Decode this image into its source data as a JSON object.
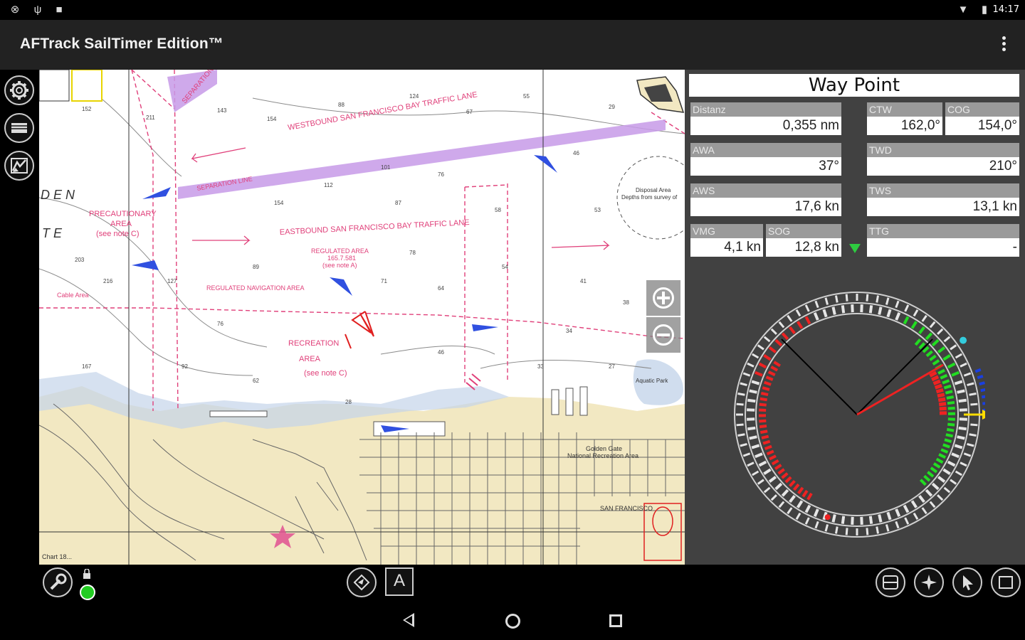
{
  "status_bar": {
    "time": "14:17",
    "left_icons": [
      "sync-icon",
      "usb-icon",
      "notification-icon"
    ],
    "right_icons": [
      "wifi-icon",
      "battery-icon"
    ]
  },
  "app": {
    "title": "AFTrack SailTimer Edition™"
  },
  "left_toolbar": {
    "buttons": [
      "settings-gear-icon",
      "layers-icon",
      "chart-map-icon"
    ]
  },
  "chart": {
    "labels": {
      "westbound": "WESTBOUND SAN FRANCISCO BAY TRAFFIC LANE",
      "eastbound": "EASTBOUND SAN FRANCISCO BAY TRAFFIC LANE",
      "precautionary": "PRECAUTIONARY",
      "precautionary_area": "AREA",
      "precautionary_note": "(see note C)",
      "recreation": "RECREATION",
      "recreation_area": "AREA",
      "recreation_note": "(see note C)",
      "regulated": "REGULATED AREA",
      "regulated_num": "165.7.581",
      "regulated_note": "(see note A)",
      "regulated_nav": "REGULATED NAVIGATION AREA",
      "den": "D E N",
      "te": "T E",
      "cable_area": "Cable Area",
      "separation": "SEPARATION",
      "separation_line": "SEPARATION LINE",
      "disposal": "Disposal Area",
      "disposal_note": "Depths from survey of",
      "san_francisco": "SAN FRANCISCO",
      "golden_gate": "Golden Gate",
      "golden_gate_2": "National Recreation Area",
      "aquatic_park": "Aquatic Park",
      "chart_no": "Chart 18..."
    },
    "zoom_in": "+",
    "zoom_out": "−"
  },
  "waypoint_panel": {
    "title": "Way Point",
    "fields": {
      "distanz": {
        "label": "Distanz",
        "value": "0,355 nm"
      },
      "ctw": {
        "label": "CTW",
        "value": "162,0°"
      },
      "cog": {
        "label": "COG",
        "value": "154,0°"
      },
      "awa": {
        "label": "AWA",
        "value": "37°"
      },
      "twd": {
        "label": "TWD",
        "value": "210°"
      },
      "aws": {
        "label": "AWS",
        "value": "17,6 kn"
      },
      "tws": {
        "label": "TWS",
        "value": "13,1 kn"
      },
      "vmg": {
        "label": "VMG",
        "value": "4,1 kn"
      },
      "sog": {
        "label": "SOG",
        "value": "12,8 kn"
      },
      "ttg": {
        "label": "TTG",
        "value": "-"
      }
    },
    "vmg_indicator_color": "#2ecc40"
  },
  "gauge": {
    "apparent_wind_angle_deg": 37,
    "heading_ref": "up",
    "needle_red_deg": 60,
    "needle_black_1_deg": 45,
    "needle_black_2_deg": -45,
    "yellow_arrow_deg": 90,
    "colors": {
      "port": "#ee2222",
      "starboard": "#22dd22",
      "blue": "#1a3fe0",
      "yellow": "#ffdd00",
      "cyan": "#33ccdd"
    }
  },
  "bottom_toolbar": {
    "left_buttons": [
      "tools-icon",
      "lock-icon",
      "gps-status-icon"
    ],
    "center_buttons": [
      "route-icon",
      "text-annotation-icon"
    ],
    "center_label": "A",
    "right_buttons": [
      "display-layout-icon",
      "compass-rose-icon",
      "cursor-icon",
      "fullscreen-icon"
    ],
    "gps_color": "#22cc22"
  }
}
